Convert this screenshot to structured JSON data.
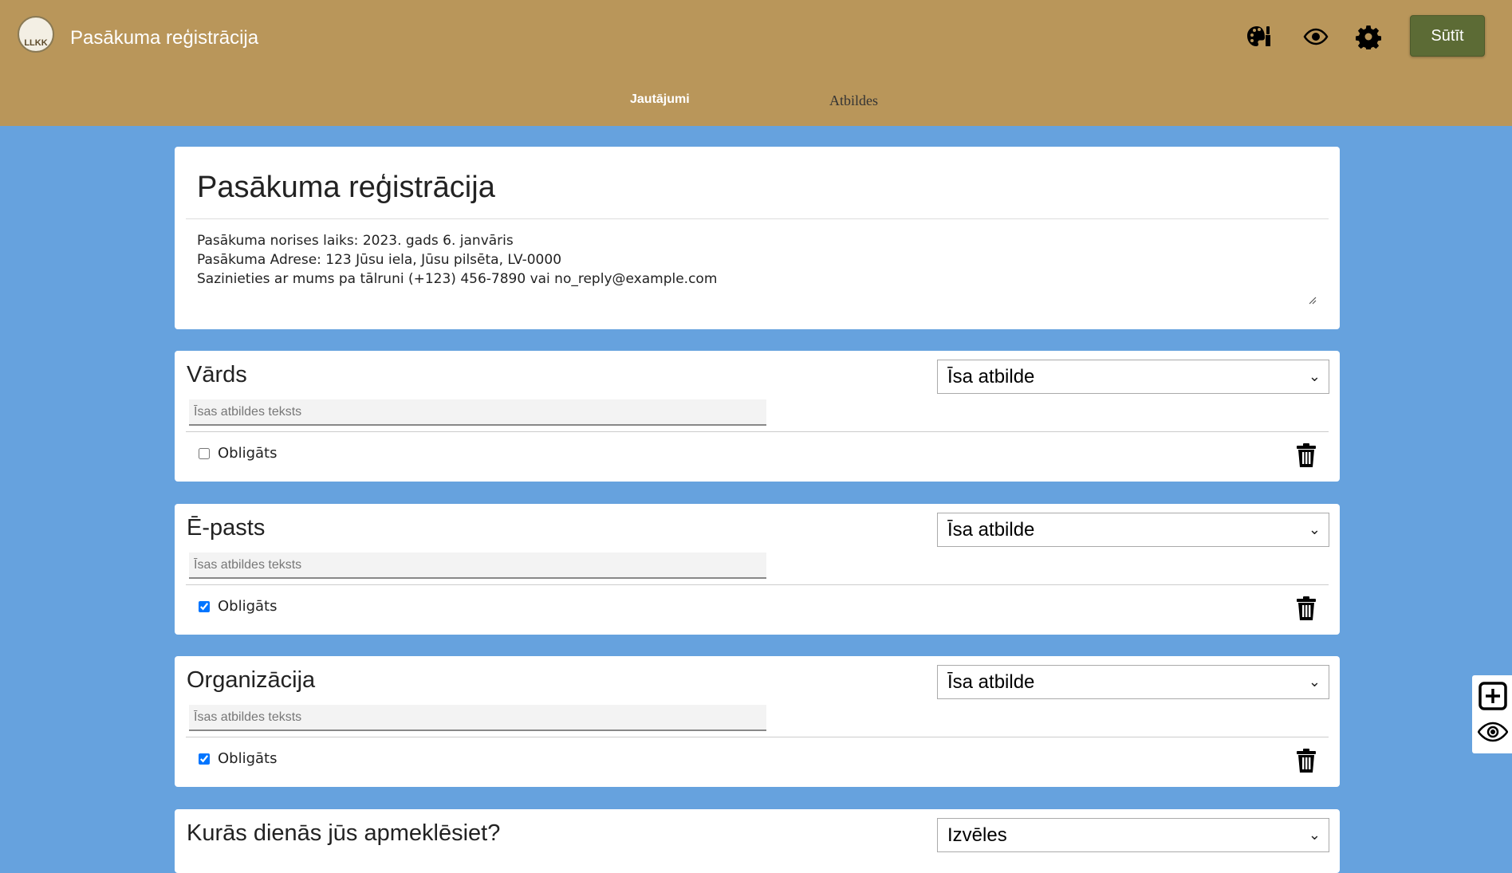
{
  "header": {
    "logo_text": "LLKK",
    "title": "Pasākuma reģistrācija",
    "icons": [
      "palette-icon",
      "eye-icon",
      "gear-icon"
    ],
    "send_label": "Sūtīt",
    "tabs": [
      {
        "label": "Jautājumi",
        "active": true
      },
      {
        "label": "Atbildes",
        "active": false
      }
    ]
  },
  "form": {
    "title": "Pasākuma reģistrācija",
    "description": "Pasākuma norises laiks: 2023. gads 6. janvāris\nPasākuma Adrese: 123 Jūsu iela, Jūsu pilsēta, LV-0000\nSazinieties ar mums pa tālruni (+123) 456-7890 vai no_reply@example.com"
  },
  "questions": [
    {
      "title": "Vārds",
      "type": "Īsa atbilde",
      "answer_placeholder": "Īsas atbildes teksts",
      "required_label": "Obligāts",
      "required": false
    },
    {
      "title": "Ē-pasts",
      "type": "Īsa atbilde",
      "answer_placeholder": "Īsas atbildes teksts",
      "required_label": "Obligāts",
      "required": true
    },
    {
      "title": "Organizācija",
      "type": "Īsa atbilde",
      "answer_placeholder": "Īsas atbildes teksts",
      "required_label": "Obligāts",
      "required": true
    },
    {
      "title": "Kurās dienās jūs apmeklēsiet?",
      "type": "Izvēles"
    }
  ],
  "side_panel": {
    "icons": [
      "add-question-icon",
      "preview-eye-icon"
    ]
  },
  "colors": {
    "header": "#b9965a",
    "background": "#66a2de",
    "send_button": "#5c6b35"
  }
}
